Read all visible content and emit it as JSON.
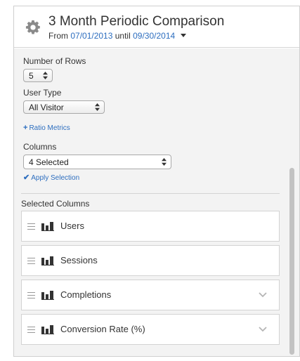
{
  "header": {
    "title": "3 Month Periodic Comparison",
    "from_label": "From",
    "start_date": "07/01/2013",
    "until_label": "until",
    "end_date": "09/30/2014"
  },
  "settings": {
    "rows_label": "Number of Rows",
    "rows_value": "5",
    "user_type_label": "User Type",
    "user_type_value": "All Visitor",
    "ratio_metrics_icon": "+",
    "ratio_metrics_link": "Ratio Metrics",
    "columns_label": "Columns",
    "columns_value": "4 Selected",
    "apply_icon": "✔",
    "apply_link": "Apply Selection"
  },
  "selected_columns": {
    "label": "Selected Columns",
    "items": [
      {
        "label": "Users"
      },
      {
        "label": "Sessions"
      },
      {
        "label": "Completions"
      },
      {
        "label": "Conversion Rate (%)"
      }
    ]
  },
  "icons": {
    "settings": "gear-icon",
    "drag": "drag-handle-icon",
    "metric": "bar-chart-icon",
    "expand": "chevron-down-icon",
    "stepper": "up-down-arrows-icon"
  },
  "colors": {
    "link": "#2d6ebf",
    "panel_bg": "#f3f3f3",
    "scrollbar": "#c2c2c2"
  }
}
